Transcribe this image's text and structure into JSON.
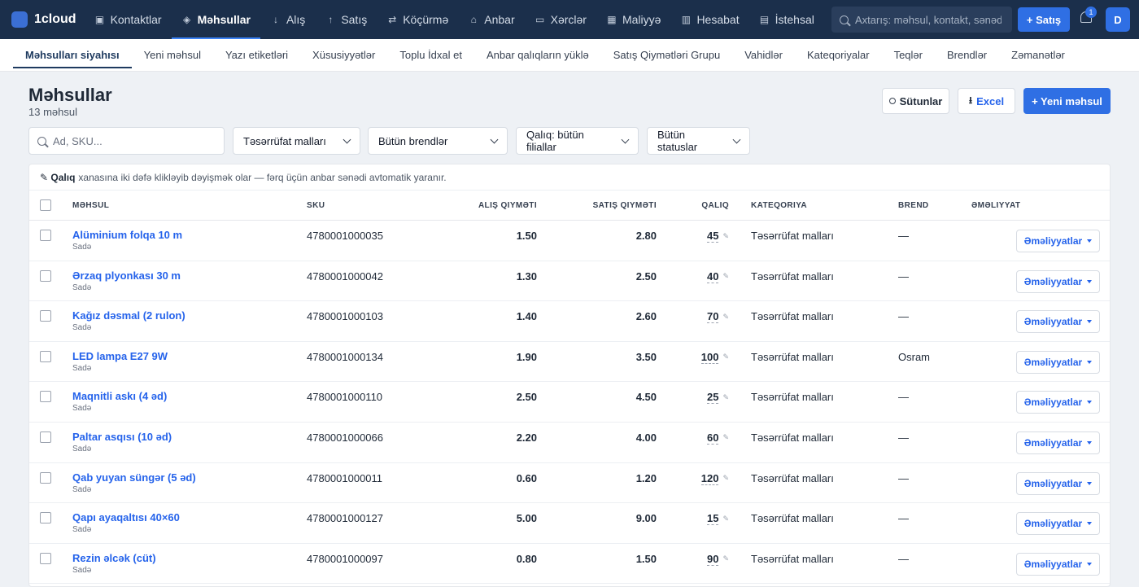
{
  "topnav": {
    "brand": "1cloud",
    "items": [
      {
        "label": "Kontaktlar",
        "icon": "contacts-icon",
        "glyph": "▣"
      },
      {
        "label": "Məhsullar",
        "icon": "box-icon",
        "glyph": "◈",
        "active": true
      },
      {
        "label": "Alış",
        "icon": "purchase-icon",
        "glyph": "↓"
      },
      {
        "label": "Satış",
        "icon": "sale-icon",
        "glyph": "↑"
      },
      {
        "label": "Köçürmə",
        "icon": "transfer-icon",
        "glyph": "⇄"
      },
      {
        "label": "Anbar",
        "icon": "warehouse-icon",
        "glyph": "⌂"
      },
      {
        "label": "Xərclər",
        "icon": "expenses-icon",
        "glyph": "▭"
      },
      {
        "label": "Maliyyə",
        "icon": "finance-icon",
        "glyph": "▦"
      },
      {
        "label": "Hesabat",
        "icon": "report-icon",
        "glyph": "▥"
      },
      {
        "label": "İstehsal",
        "icon": "production-icon",
        "glyph": "▤"
      }
    ],
    "search_placeholder": "Axtarış: məhsul, kontakt, sənəd...",
    "sale_button": "+ Satış",
    "notification_count": "1",
    "avatar_initial": "D"
  },
  "subnav": {
    "items": [
      {
        "label": "Məhsulları siyahısı",
        "active": true
      },
      {
        "label": "Yeni məhsul"
      },
      {
        "label": "Yazı etiketləri"
      },
      {
        "label": "Xüsusiyyətlər"
      },
      {
        "label": "Toplu İdxal et"
      },
      {
        "label": "Anbar qalıqların yüklə"
      },
      {
        "label": "Satış Qiymətləri Grupu"
      },
      {
        "label": "Vahidlər"
      },
      {
        "label": "Kateqoriyalar"
      },
      {
        "label": "Teqlər"
      },
      {
        "label": "Brendlər"
      },
      {
        "label": "Zəmanətlər"
      }
    ]
  },
  "page": {
    "title": "Məhsullar",
    "subtitle": "13 məhsul",
    "columns_button": "Sütunlar",
    "excel_button": "Excel",
    "new_button": "+ Yeni məhsul"
  },
  "filters": {
    "search_placeholder": "Ad, SKU...",
    "category": "Təsərrüfat malları",
    "brand": "Bütün brendlər",
    "stock": "Qalıq: bütün filiallar",
    "status": "Bütün statuslar"
  },
  "hint": {
    "bold": "✎ Qalıq",
    "text": "xanasına iki dəfə klikləyib dəyişmək olar — fərq üçün anbar sənədi avtomatik yaranır."
  },
  "table": {
    "headers": {
      "product": "Məhsul",
      "sku": "SKU",
      "buy_price": "Alış qiyməti",
      "sell_price": "Satış qiyməti",
      "stock": "Qalıq",
      "category": "Kateqoriya",
      "brand": "Brend",
      "actions": "Əməliyyat"
    },
    "action_label": "Əməliyyatlar",
    "rows": [
      {
        "name": "Alüminium folqa 10 m",
        "type": "Sadə",
        "sku": "4780001000035",
        "buy": "1.50",
        "sell": "2.80",
        "stock": "45",
        "category": "Təsərrüfat malları",
        "brand": "—"
      },
      {
        "name": "Ərzaq plyonkası 30 m",
        "type": "Sadə",
        "sku": "4780001000042",
        "buy": "1.30",
        "sell": "2.50",
        "stock": "40",
        "category": "Təsərrüfat malları",
        "brand": "—"
      },
      {
        "name": "Kağız dəsmal (2 rulon)",
        "type": "Sadə",
        "sku": "4780001000103",
        "buy": "1.40",
        "sell": "2.60",
        "stock": "70",
        "category": "Təsərrüfat malları",
        "brand": "—"
      },
      {
        "name": "LED lampa E27 9W",
        "type": "Sadə",
        "sku": "4780001000134",
        "buy": "1.90",
        "sell": "3.50",
        "stock": "100",
        "category": "Təsərrüfat malları",
        "brand": "Osram"
      },
      {
        "name": "Maqnitli askı (4 əd)",
        "type": "Sadə",
        "sku": "4780001000110",
        "buy": "2.50",
        "sell": "4.50",
        "stock": "25",
        "category": "Təsərrüfat malları",
        "brand": "—"
      },
      {
        "name": "Paltar asqısı (10 əd)",
        "type": "Sadə",
        "sku": "4780001000066",
        "buy": "2.20",
        "sell": "4.00",
        "stock": "60",
        "category": "Təsərrüfat malları",
        "brand": "—"
      },
      {
        "name": "Qab yuyan süngər (5 əd)",
        "type": "Sadə",
        "sku": "4780001000011",
        "buy": "0.60",
        "sell": "1.20",
        "stock": "120",
        "category": "Təsərrüfat malları",
        "brand": "—"
      },
      {
        "name": "Qapı ayaqaltısı 40×60",
        "type": "Sadə",
        "sku": "4780001000127",
        "buy": "5.00",
        "sell": "9.00",
        "stock": "15",
        "category": "Təsərrüfat malları",
        "brand": "—"
      },
      {
        "name": "Rezin əlcək (cüt)",
        "type": "Sadə",
        "sku": "4780001000097",
        "buy": "0.80",
        "sell": "1.50",
        "stock": "90",
        "category": "Təsərrüfat malları",
        "brand": "—"
      }
    ]
  }
}
